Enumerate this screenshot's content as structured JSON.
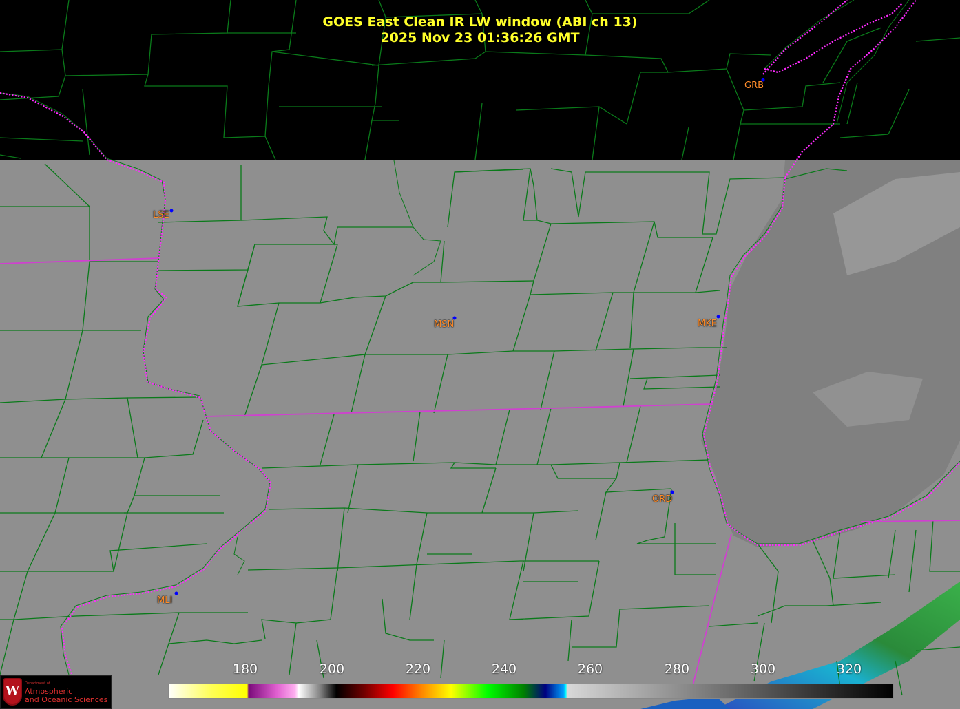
{
  "header": {
    "title_line1": "GOES East Clean IR LW window (ABI ch 13)",
    "title_line2": "2025 Nov 23  01:36:26 GMT"
  },
  "stations": [
    {
      "id": "GRB"
    },
    {
      "id": "LSE"
    },
    {
      "id": "MSN"
    },
    {
      "id": "MKE"
    },
    {
      "id": "ORD"
    },
    {
      "id": "MLI"
    }
  ],
  "colorbar": {
    "ticks": [
      "180",
      "200",
      "220",
      "240",
      "260",
      "280",
      "300",
      "320"
    ]
  },
  "logo": {
    "dept": "Department of",
    "line1": "Atmospheric",
    "line2": "and Oceanic Sciences"
  },
  "colors": {
    "title": "#ffff2a",
    "county_lines": "#0a7a1a",
    "state_borders": "#ff2aff",
    "station_label": "#ff8c2a",
    "station_dot": "#0000ff",
    "land_ir": "#8f8f8f",
    "lake_ir": "#808080"
  }
}
